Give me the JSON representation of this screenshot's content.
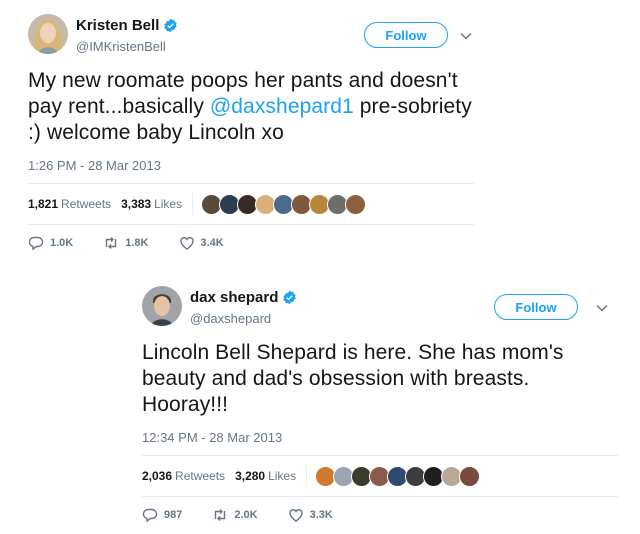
{
  "tweets": [
    {
      "author": "Kristen Bell",
      "handle": "@IMKristenBell",
      "follow_label": "Follow",
      "text_before": "My new roomate poops her pants and doesn't pay rent...basically ",
      "mention": "@daxshepard1",
      "text_after": " pre-sobriety :) welcome baby Lincoln xo",
      "timestamp": "1:26 PM - 28 Mar 2013",
      "retweets_count": "1,821",
      "retweets_label": "Retweets",
      "likes_count": "3,383",
      "likes_label": "Likes",
      "replies": "1.0K",
      "retweets_short": "1.8K",
      "likes_short": "3.4K",
      "liker_colors": [
        "#5a4a3a",
        "#2c3e50",
        "#3a2a22",
        "#d8b07a",
        "#4a6b8a",
        "#7b5a3e",
        "#b8863b",
        "#6e6e6e",
        "#8a6040"
      ]
    },
    {
      "author": "dax shepard",
      "handle": "@daxshepard",
      "follow_label": "Follow",
      "text_before": "Lincoln Bell Shepard is here. She has mom's beauty and dad's obsession with breasts. Hooray!!!",
      "mention": "",
      "text_after": "",
      "timestamp": "12:34 PM - 28 Mar 2013",
      "retweets_count": "2,036",
      "retweets_label": "Retweets",
      "likes_count": "3,280",
      "likes_label": "Likes",
      "replies": "987",
      "retweets_short": "2.0K",
      "likes_short": "3.3K",
      "liker_colors": [
        "#d0782c",
        "#9aa5b1",
        "#3b3b2e",
        "#8c5a4a",
        "#2e4a6e",
        "#3d3d3d",
        "#1f1f1f",
        "#b7a898",
        "#7a4a3a"
      ]
    }
  ],
  "colors": {
    "accent": "#1da1f2",
    "secondary_text": "#657786",
    "divider": "#e6ecf0"
  },
  "icons": [
    "verified-badge-icon",
    "chevron-down-icon",
    "reply-icon",
    "retweet-icon",
    "heart-icon"
  ]
}
